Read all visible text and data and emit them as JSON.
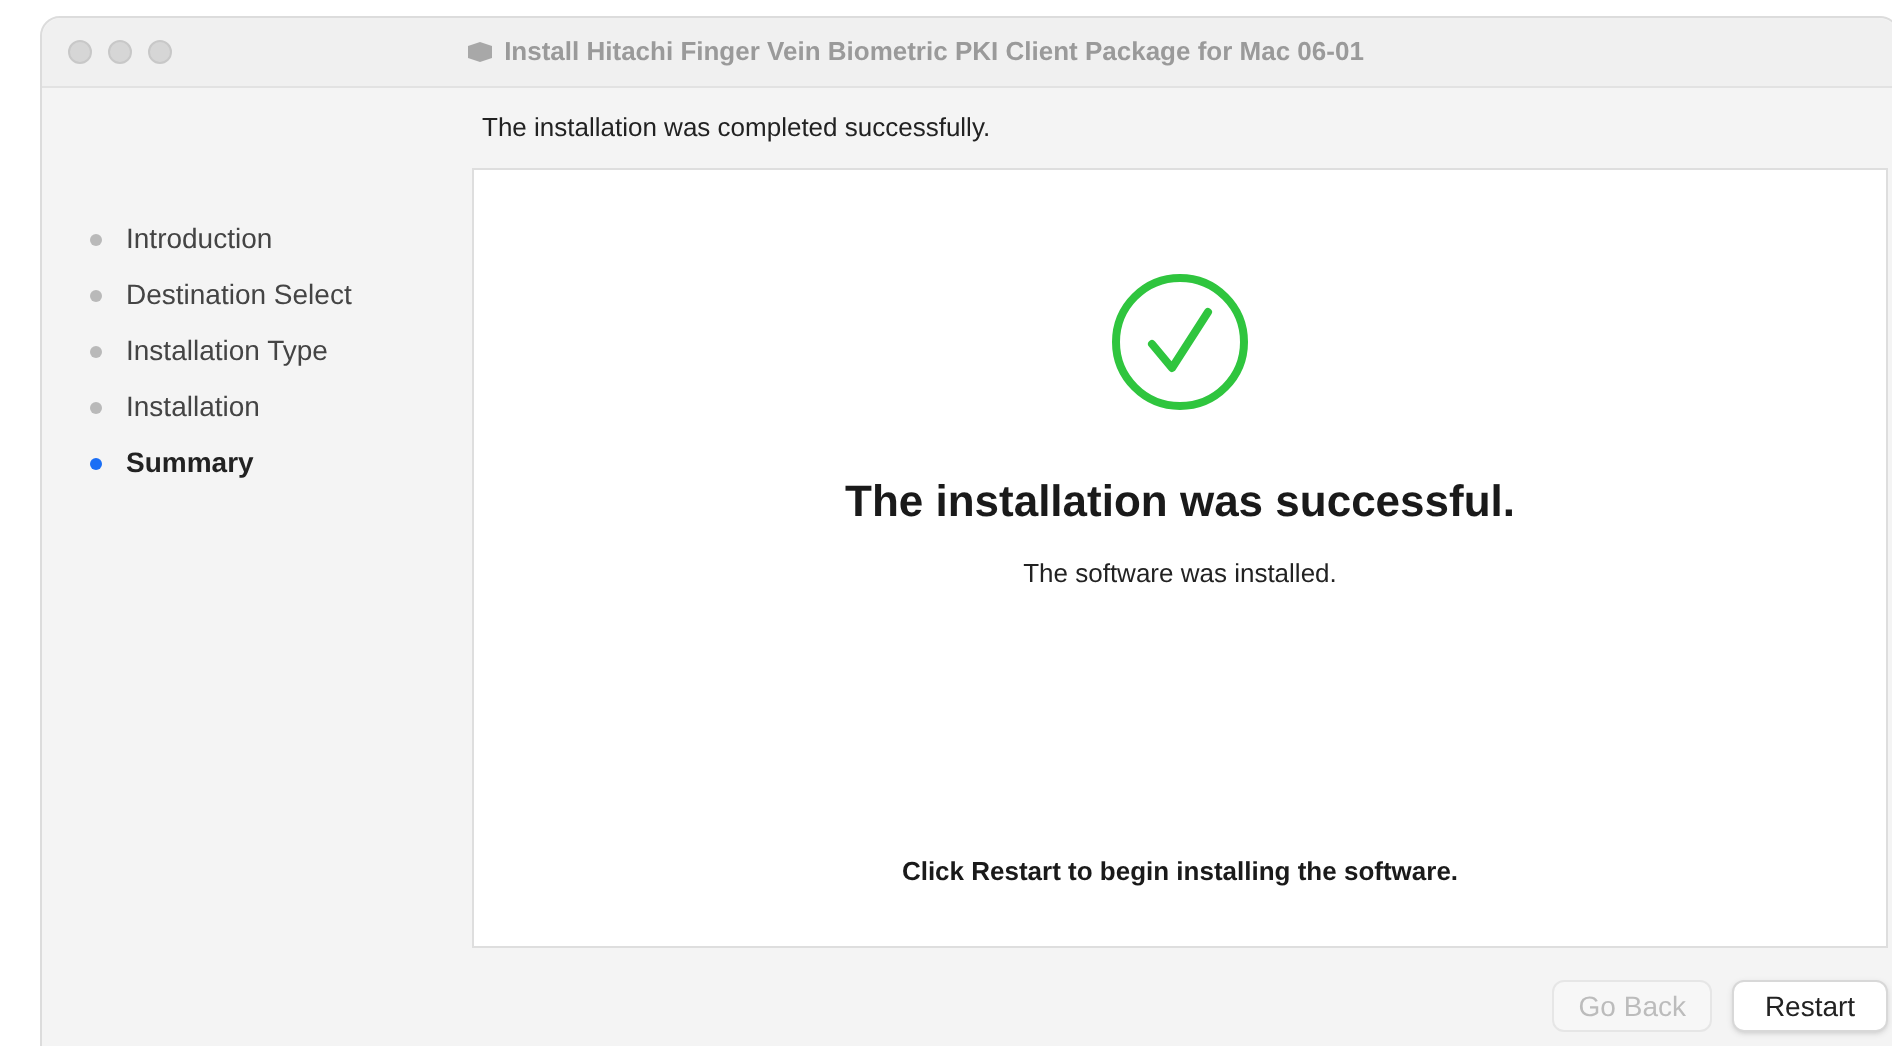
{
  "window": {
    "title": "Install Hitachi Finger Vein Biometric PKI Client Package for Mac 06-01"
  },
  "sidebar": {
    "items": [
      {
        "label": "Introduction",
        "selected": false
      },
      {
        "label": "Destination Select",
        "selected": false
      },
      {
        "label": "Installation Type",
        "selected": false
      },
      {
        "label": "Installation",
        "selected": false
      },
      {
        "label": "Summary",
        "selected": true
      }
    ]
  },
  "header": "The installation was completed successfully.",
  "content": {
    "heading": "The installation was successful.",
    "subtitle": "The software was installed.",
    "instruction": "Click Restart to begin installing the software."
  },
  "buttons": [
    {
      "label": "Go Back",
      "disabled": true
    },
    {
      "label": "Restart",
      "disabled": false
    }
  ]
}
